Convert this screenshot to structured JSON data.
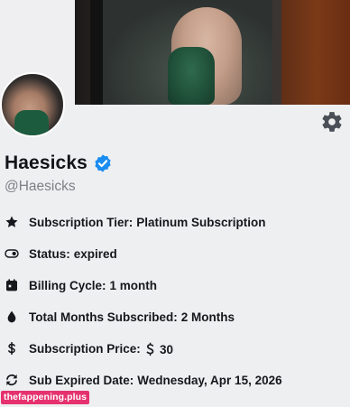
{
  "profile": {
    "name": "Haesicks",
    "handle": "@Haesicks",
    "verified": true,
    "accent_color": "#1a8df0"
  },
  "details": [
    {
      "icon": "star-icon",
      "label": "Subscription Tier:",
      "value": "Platinum Subscription"
    },
    {
      "icon": "toggle-icon",
      "label": "Status:",
      "value": "expired"
    },
    {
      "icon": "calendar-icon",
      "label": "Billing Cycle:",
      "value": "1 month"
    },
    {
      "icon": "droplet-icon",
      "label": "Total Months Subscribed:",
      "value": "2 Months"
    },
    {
      "icon": "dollar-icon",
      "label": "Subscription Price:",
      "value": "＄ 30"
    },
    {
      "icon": "refresh-icon",
      "label": "Sub Expired Date:",
      "value": "Wednesday, Apr 15, 2026"
    }
  ],
  "watermark": "thefappening.plus"
}
